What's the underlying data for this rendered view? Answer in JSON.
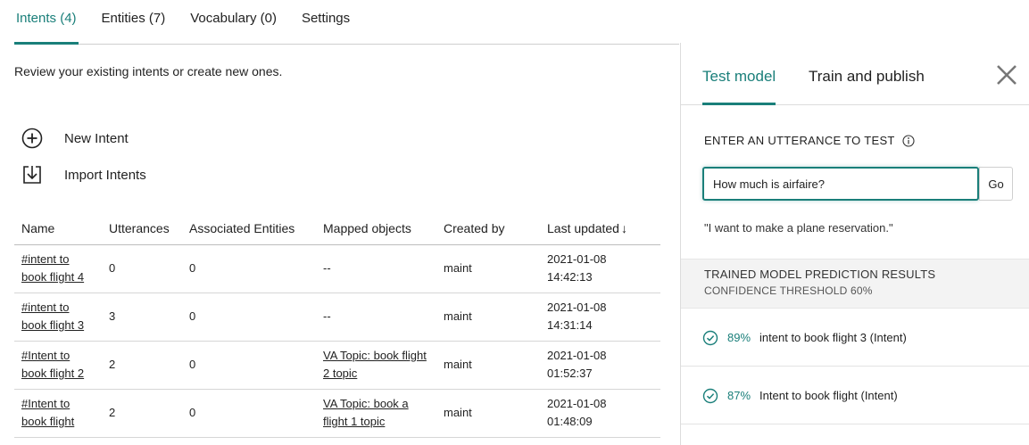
{
  "tabs": [
    {
      "label": "Intents (4)"
    },
    {
      "label": "Entities (7)"
    },
    {
      "label": "Vocabulary (0)"
    },
    {
      "label": "Settings"
    }
  ],
  "description": "Review your existing intents or create new ones.",
  "actions": {
    "new_intent": "New Intent",
    "import_intents": "Import Intents"
  },
  "table": {
    "headers": [
      "Name",
      "Utterances",
      "Associated Entities",
      "Mapped objects",
      "Created by",
      "Last updated"
    ],
    "sort_arrow": "↓",
    "rows": [
      {
        "name": "#intent to book flight 4",
        "utterances": "0",
        "entities": "0",
        "mapped": "--",
        "created_by": "maint",
        "updated_date": "2021-01-08",
        "updated_time": "14:42:13"
      },
      {
        "name": "#intent to book flight 3",
        "utterances": "3",
        "entities": "0",
        "mapped": "--",
        "created_by": "maint",
        "updated_date": "2021-01-08",
        "updated_time": "14:31:14"
      },
      {
        "name": "#Intent to book flight 2",
        "utterances": "2",
        "entities": "0",
        "mapped": "VA Topic: book flight 2 topic",
        "created_by": "maint",
        "updated_date": "2021-01-08",
        "updated_time": "01:52:37"
      },
      {
        "name": "#Intent to book flight",
        "utterances": "2",
        "entities": "0",
        "mapped": "VA Topic: book a flight 1 topic",
        "created_by": "maint",
        "updated_date": "2021-01-08",
        "updated_time": "01:48:09"
      }
    ]
  },
  "panel": {
    "tab_test": "Test model",
    "tab_train": "Train and publish",
    "utterance_label": "ENTER AN UTTERANCE TO TEST",
    "input_value": "How much is airfaire?",
    "go_label": "Go",
    "suggestion": "\"I want to make a plane reservation.\"",
    "results_title": "TRAINED MODEL PREDICTION RESULTS",
    "results_threshold": "CONFIDENCE THRESHOLD 60%",
    "results": [
      {
        "percent": "89%",
        "name": "intent to book flight 3 (Intent)"
      },
      {
        "percent": "87%",
        "name": "Intent to book flight (Intent)"
      }
    ]
  },
  "colors": {
    "accent": "#1a7f7a"
  }
}
